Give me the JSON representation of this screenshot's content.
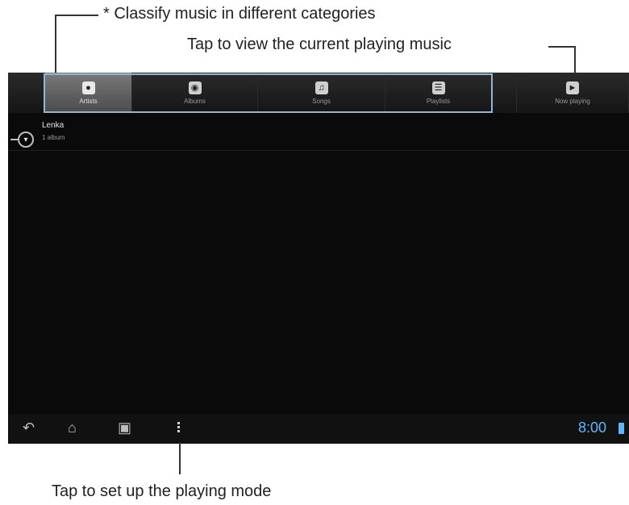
{
  "annotations": {
    "categories": "* Classify music in different categories",
    "now_playing": "Tap to view the current playing music",
    "menu": "Tap to set up the playing mode"
  },
  "tabs": [
    {
      "label": "Artists",
      "icon": "microphone-icon"
    },
    {
      "label": "Albums",
      "icon": "album-icon"
    },
    {
      "label": "Songs",
      "icon": "music-note-icon"
    },
    {
      "label": "Playlists",
      "icon": "playlist-icon"
    }
  ],
  "now_playing_tab": {
    "label": "Now playing",
    "icon": "now-playing-icon"
  },
  "list": [
    {
      "title": "Lenka",
      "subtitle": "1 album"
    }
  ],
  "status": {
    "time": "8:00"
  },
  "colors": {
    "accent": "#5fb6ff",
    "tab_outline": "#8fb7d8"
  }
}
